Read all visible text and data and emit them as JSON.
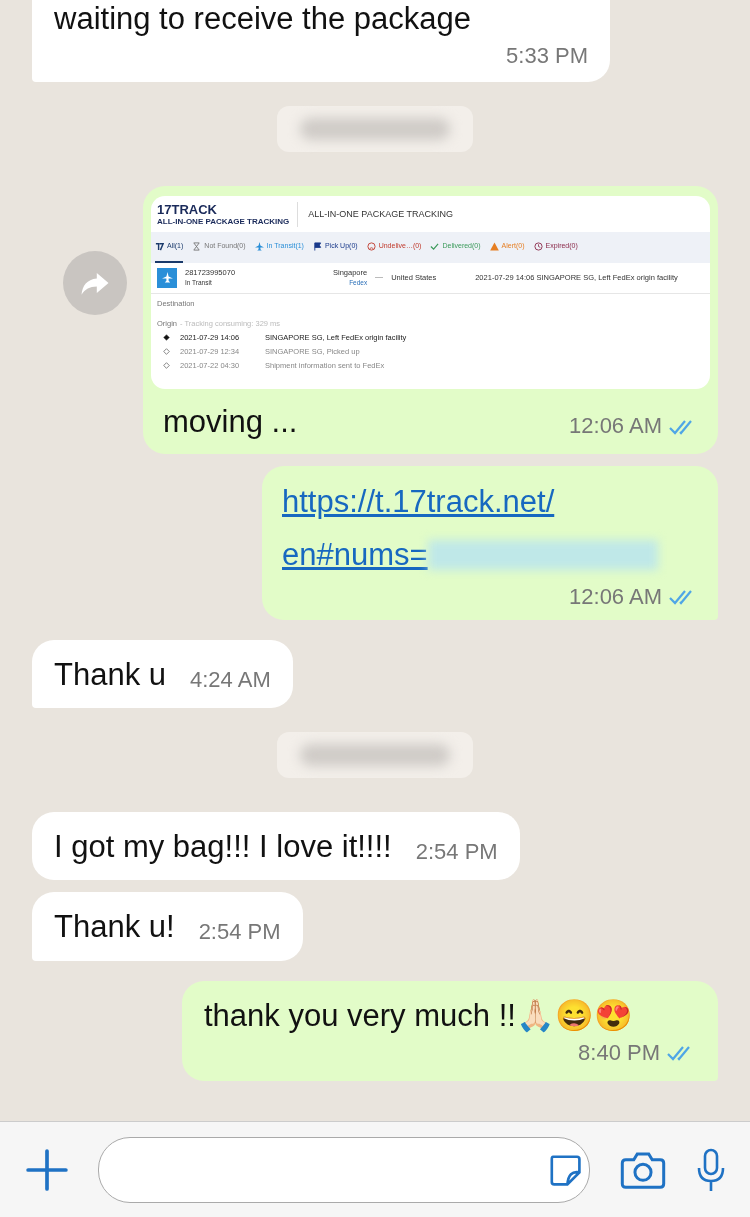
{
  "messages": [
    {
      "kind": "text",
      "outgoing": false,
      "text": "waiting to receive the package",
      "time": "5:33 PM"
    },
    {
      "kind": "blurred-date"
    },
    {
      "kind": "image",
      "outgoing": true,
      "text": "moving ...",
      "time": "12:06 AM",
      "read": true,
      "tracking": {
        "logo": "17TRACK",
        "logo_sub": "ALL-IN-ONE PACKAGE TRACKING",
        "header": "ALL-IN-ONE PACKAGE TRACKING",
        "tabs": [
          {
            "label": "All(1)",
            "selected": true
          },
          {
            "label": "Not Found(0)",
            "selected": false
          },
          {
            "label": "In Transit(1)",
            "selected": false
          },
          {
            "label": "Pick Up(0)",
            "selected": false
          },
          {
            "label": "Undelive…(0)",
            "selected": false
          },
          {
            "label": "Delivered(0)",
            "selected": false
          },
          {
            "label": "Alert(0)",
            "selected": false
          },
          {
            "label": "Expired(0)",
            "selected": false
          }
        ],
        "number": "281723995070",
        "status": "In Transit",
        "from": "Singapore",
        "carrier": "Fedex",
        "to": "United States",
        "latest": "2021-07-29 14:06  SINGAPORE SG, Left FedEx origin facility",
        "destination_label": "Destination",
        "origin_label": "Origin",
        "consuming": "- Tracking consuming: 329 ms",
        "events": [
          {
            "time": "2021-07-29 14:06",
            "text": "SINGAPORE SG, Left FedEx origin facility",
            "latest": true
          },
          {
            "time": "2021-07-29 12:34",
            "text": "SINGAPORE SG, Picked up",
            "latest": false
          },
          {
            "time": "2021-07-22 04:30",
            "text": "Shipment information sent to FedEx",
            "latest": false
          }
        ]
      }
    },
    {
      "kind": "link",
      "outgoing": true,
      "link_lines": [
        "https://t.17track.net/",
        "en#nums="
      ],
      "time": "12:06 AM",
      "read": true
    },
    {
      "kind": "text",
      "outgoing": false,
      "text": "Thank u",
      "time": "4:24 AM"
    },
    {
      "kind": "blurred-date"
    },
    {
      "kind": "text",
      "outgoing": false,
      "text": "I got my bag!!! I love it!!!!",
      "time": "2:54 PM"
    },
    {
      "kind": "text",
      "outgoing": false,
      "text": "Thank u!",
      "time": "2:54 PM"
    },
    {
      "kind": "text",
      "outgoing": true,
      "text": "thank you very much !!🙏🏻😄😍",
      "time": "8:40 PM",
      "read": true
    }
  ]
}
